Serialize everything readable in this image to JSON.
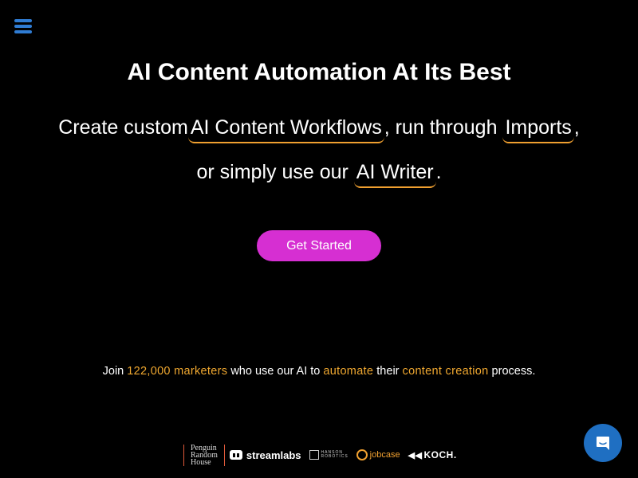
{
  "header": {
    "menu_icon": "hamburger-menu-icon"
  },
  "hero": {
    "headline": "AI Content Automation At Its Best",
    "line1_prefix": "Create custom",
    "link_workflows": "AI Content Workflows",
    "line1_mid": ", run through",
    "link_imports": "Imports",
    "line1_suffix": ",",
    "line2_prefix": "or simply use our",
    "link_writer": "AI Writer",
    "line2_suffix": ".",
    "cta_label": "Get Started"
  },
  "social_proof": {
    "part1": "Join",
    "count": "122,000 marketers",
    "part2": "who use our AI to",
    "highlight1": "automate",
    "part3": "their",
    "highlight2": "content creation",
    "part4": "process."
  },
  "logos": {
    "prh_line1": "Penguin",
    "prh_line2": "Random",
    "prh_line3": "House",
    "streamlabs": "streamlabs",
    "hanson_line1": "HANSON",
    "hanson_line2": "ROBOTICS",
    "jobcase": "jobcase",
    "koch": "KOCH."
  },
  "chat": {
    "icon": "chat-bubble-icon"
  },
  "colors": {
    "background": "#000000",
    "accent_link_underline": "#f0a030",
    "cta": "#d62fd2",
    "menu_icon": "#2f7cd3",
    "chat_button": "#1f6fc2"
  }
}
